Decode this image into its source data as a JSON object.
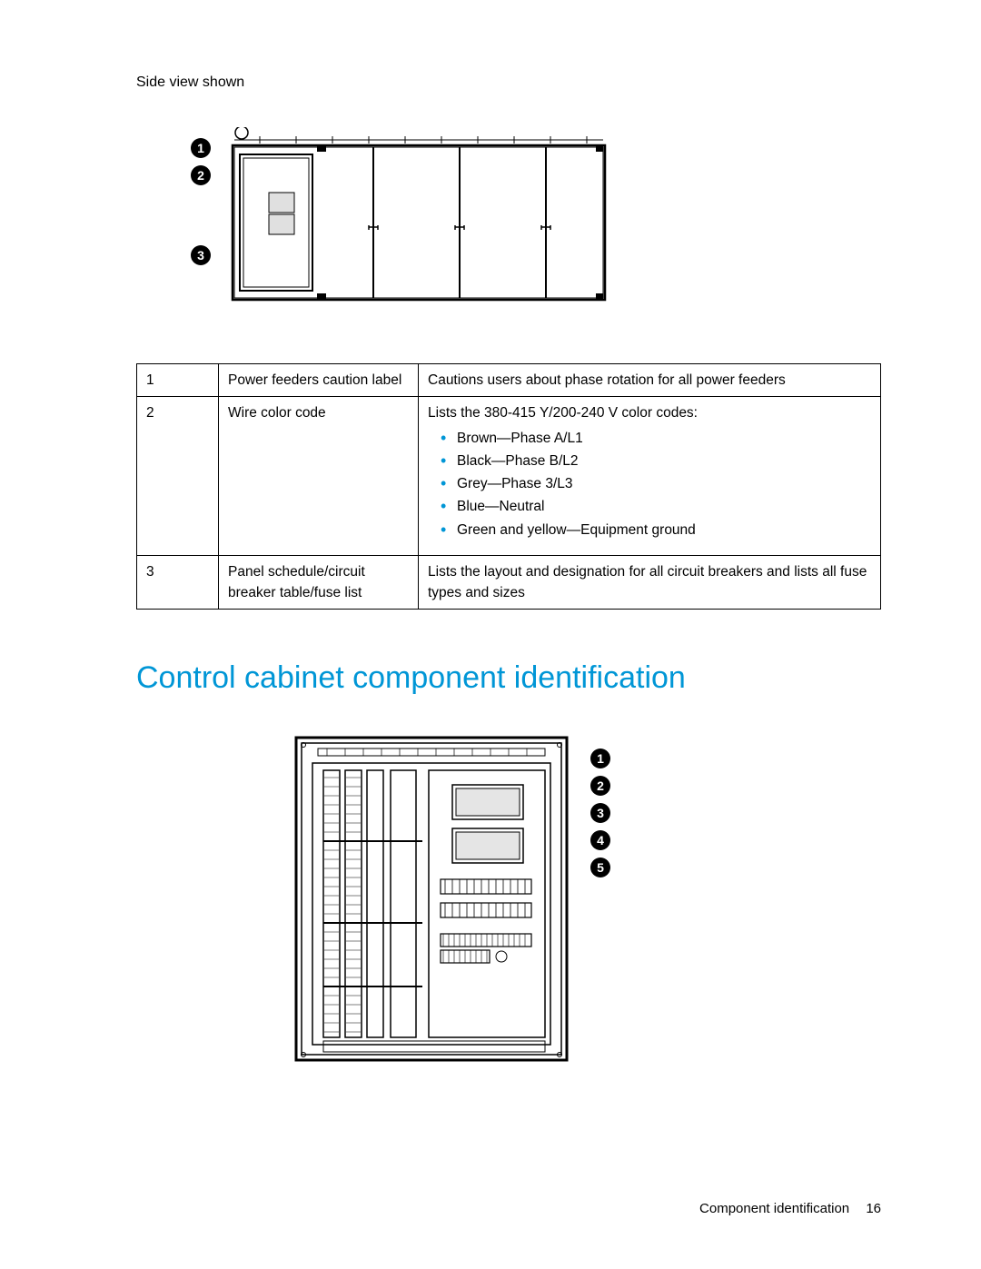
{
  "caption_top": "Side view shown",
  "fig1_callouts": [
    "1",
    "2",
    "3"
  ],
  "table_rows": [
    {
      "num": "1",
      "name": "Power feeders caution label",
      "desc": "Cautions users about phase rotation for all power feeders"
    },
    {
      "num": "2",
      "name": "Wire color code",
      "desc_intro": "Lists the 380-415 Y/200-240 V color codes:",
      "bullets": [
        "Brown—Phase A/L1",
        "Black—Phase B/L2",
        "Grey—Phase 3/L3",
        "Blue—Neutral",
        "Green and yellow—Equipment ground"
      ]
    },
    {
      "num": "3",
      "name": "Panel schedule/circuit breaker table/fuse list",
      "desc": "Lists the layout and designation for all circuit breakers and lists all fuse types and sizes"
    }
  ],
  "section_heading": "Control cabinet component identification",
  "fig2_callouts": [
    "1",
    "2",
    "3",
    "4",
    "5"
  ],
  "footer_text": "Component identification",
  "footer_page": "16"
}
